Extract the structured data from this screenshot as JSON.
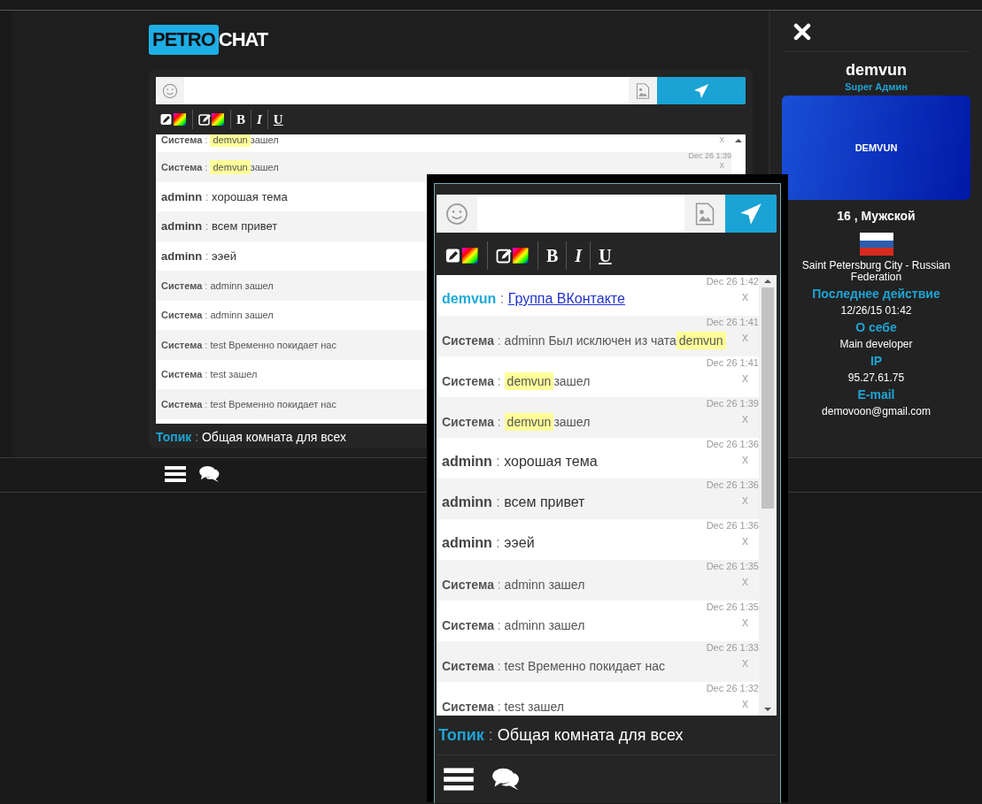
{
  "logo": {
    "part_1": "PETRO",
    "part_2": "CHAT"
  },
  "desktop_chat": {
    "toolbar": [
      {
        "kind": "text-color"
      },
      {
        "kind": "bg-color"
      },
      {
        "kind": "bold",
        "label": "B"
      },
      {
        "kind": "italic",
        "label": "I"
      },
      {
        "kind": "underline",
        "label": "U"
      }
    ],
    "messages": [
      {
        "kind": "system",
        "sender": "Система",
        "sep": ":",
        "parts": [
          {
            "kind": "highlight",
            "text": "demvun"
          },
          {
            "kind": "plain",
            "text": "зашел"
          }
        ],
        "close": "x"
      },
      {
        "kind": "system",
        "sender": "Система",
        "sep": ":",
        "parts": [
          {
            "kind": "highlight",
            "text": "demvun"
          },
          {
            "kind": "plain",
            "text": "зашел"
          }
        ],
        "time": "Dec 26 1:39",
        "close": "x"
      },
      {
        "kind": "user",
        "sender": "adminn",
        "sep": ":",
        "parts": [
          {
            "kind": "plain",
            "text": "хорошая тема"
          }
        ]
      },
      {
        "kind": "user",
        "sender": "adminn",
        "sep": ":",
        "parts": [
          {
            "kind": "plain",
            "text": "всем привет"
          }
        ]
      },
      {
        "kind": "user",
        "sender": "adminn",
        "sep": ":",
        "parts": [
          {
            "kind": "plain",
            "text": "ээей"
          }
        ]
      },
      {
        "kind": "system",
        "sender": "Система",
        "sep": ":",
        "parts": [
          {
            "kind": "plain",
            "text": "adminn зашел"
          }
        ]
      },
      {
        "kind": "system",
        "sender": "Система",
        "sep": ":",
        "parts": [
          {
            "kind": "plain",
            "text": "adminn зашел"
          }
        ]
      },
      {
        "kind": "system",
        "sender": "Система",
        "sep": ":",
        "parts": [
          {
            "kind": "plain",
            "text": "test Временно покидает нас"
          }
        ]
      },
      {
        "kind": "system",
        "sender": "Система",
        "sep": ":",
        "parts": [
          {
            "kind": "plain",
            "text": "test зашел"
          }
        ]
      },
      {
        "kind": "system",
        "sender": "Система",
        "sep": ":",
        "parts": [
          {
            "kind": "plain",
            "text": "test Временно покидает нас"
          }
        ]
      }
    ],
    "topic": {
      "label": "Топик",
      "sep": ":",
      "text": "Общая комната для всех"
    }
  },
  "mobile_chat": {
    "toolbar": [
      {
        "kind": "text-color"
      },
      {
        "kind": "bg-color"
      },
      {
        "kind": "bold",
        "label": "B"
      },
      {
        "kind": "italic",
        "label": "I"
      },
      {
        "kind": "underline",
        "label": "U"
      }
    ],
    "messages": [
      {
        "kind": "self",
        "sender": "demvun",
        "sep": ":",
        "parts": [
          {
            "kind": "link",
            "text": "Группа ВКонтакте"
          }
        ],
        "time": "Dec 26 1:42",
        "close": "x"
      },
      {
        "kind": "system",
        "sender": "Система",
        "sep": ":",
        "parts": [
          {
            "kind": "plain",
            "text": "adminn Был исключен из чата"
          },
          {
            "kind": "highlight",
            "text": "demvun"
          }
        ],
        "time": "Dec 26 1:41",
        "close": "x"
      },
      {
        "kind": "system",
        "sender": "Система",
        "sep": ":",
        "parts": [
          {
            "kind": "highlight",
            "text": "demvun"
          },
          {
            "kind": "plain",
            "text": "зашел"
          }
        ],
        "time": "Dec 26 1:41",
        "close": "x"
      },
      {
        "kind": "system",
        "sender": "Система",
        "sep": ":",
        "parts": [
          {
            "kind": "highlight",
            "text": "demvun"
          },
          {
            "kind": "plain",
            "text": "зашел"
          }
        ],
        "time": "Dec 26 1:39",
        "close": "x"
      },
      {
        "kind": "user",
        "sender": "adminn",
        "sep": ":",
        "parts": [
          {
            "kind": "plain",
            "text": "хорошая тема"
          }
        ],
        "time": "Dec 26 1:36",
        "close": "x"
      },
      {
        "kind": "user",
        "sender": "adminn",
        "sep": ":",
        "parts": [
          {
            "kind": "plain",
            "text": "всем привет"
          }
        ],
        "time": "Dec 26 1:36",
        "close": "x"
      },
      {
        "kind": "user",
        "sender": "adminn",
        "sep": ":",
        "parts": [
          {
            "kind": "plain",
            "text": "ээей"
          }
        ],
        "time": "Dec 26 1:36",
        "close": "x"
      },
      {
        "kind": "system",
        "sender": "Система",
        "sep": ":",
        "parts": [
          {
            "kind": "plain",
            "text": "adminn зашел"
          }
        ],
        "time": "Dec 26 1:35",
        "close": "x"
      },
      {
        "kind": "system",
        "sender": "Система",
        "sep": ":",
        "parts": [
          {
            "kind": "plain",
            "text": "adminn зашел"
          }
        ],
        "time": "Dec 26 1:35",
        "close": "x"
      },
      {
        "kind": "system",
        "sender": "Система",
        "sep": ":",
        "parts": [
          {
            "kind": "plain",
            "text": "test Временно покидает нас"
          }
        ],
        "time": "Dec 26 1:33",
        "close": "x"
      },
      {
        "kind": "system",
        "sender": "Система",
        "sep": ":",
        "parts": [
          {
            "kind": "plain",
            "text": "test зашел"
          }
        ],
        "time": "Dec 26 1:32",
        "close": "x"
      }
    ],
    "topic": {
      "label": "Топик",
      "sep": ":",
      "text": "Общая комната для всех"
    }
  },
  "profile": {
    "name": "demvun",
    "role": "Super Админ",
    "avatar_text": "DEMVUN",
    "age_gender": "16 , Мужской",
    "location": "Saint Petersburg City - Russian Federation",
    "fields": [
      {
        "label": "Последнее действие",
        "value": "12/26/15 01:42"
      },
      {
        "label": "О себе",
        "value": "Main developer"
      },
      {
        "label": "IP",
        "value": "95.27.61.75"
      },
      {
        "label": "E-mail",
        "value": "demovoon@gmail.com"
      }
    ]
  }
}
